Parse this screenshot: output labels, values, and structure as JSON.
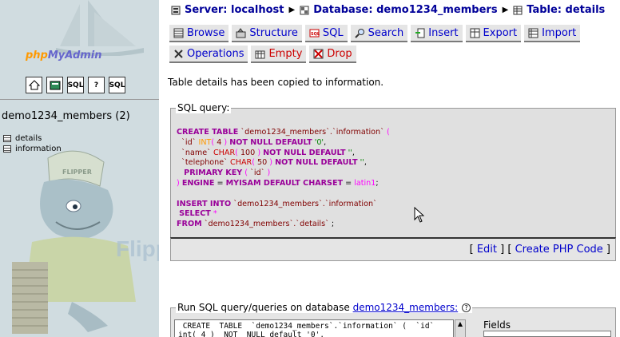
{
  "left": {
    "logo_php": "php",
    "logo_myadmin": "MyAdmin",
    "icons": [
      "home-icon",
      "query-window-icon",
      "sql-icon",
      "docs-icon",
      "sql-docs-icon"
    ],
    "icon_labels": [
      "",
      "",
      "SQL",
      "?",
      "SQL"
    ],
    "db_name": "demo1234_members (2)",
    "tables": [
      "details",
      "information"
    ]
  },
  "breadcrumb": {
    "server": "Server: localhost",
    "database": "Database: demo1234_members",
    "table": "Table: details"
  },
  "tabs_row1": [
    "Browse",
    "Structure",
    "SQL",
    "Search",
    "Insert",
    "Export",
    "Import"
  ],
  "tabs_row2": [
    "Operations",
    "Empty",
    "Drop"
  ],
  "message": "Table details has been copied to information.",
  "sql_box": {
    "legend": "SQL query:",
    "lines": [
      "CREATE TABLE `demo1234_members`.`information` (",
      "`id` INT( 4 ) NOT NULL DEFAULT '0',",
      "`name` CHAR( 100 ) NOT NULL DEFAULT '',",
      "`telephone` CHAR( 50 ) NOT NULL DEFAULT '',",
      "PRIMARY KEY ( `id` )",
      ") ENGINE = MYISAM DEFAULT CHARSET = latin1;",
      "INSERT INTO `demo1234_members`.`information`",
      "SELECT *",
      "FROM `demo1234_members`.`details` ;"
    ],
    "edit_link": "Edit",
    "php_link": "Create PHP Code"
  },
  "run_box": {
    "legend_prefix": "Run SQL query/queries on database ",
    "legend_db": "demo1234_members:",
    "textarea_value": " CREATE  TABLE  `demo1234_members`.`information` (  `id`\nint( 4 )  NOT  NULL default '0',",
    "fields_label": "Fields"
  },
  "watermark": "FlipperHost"
}
